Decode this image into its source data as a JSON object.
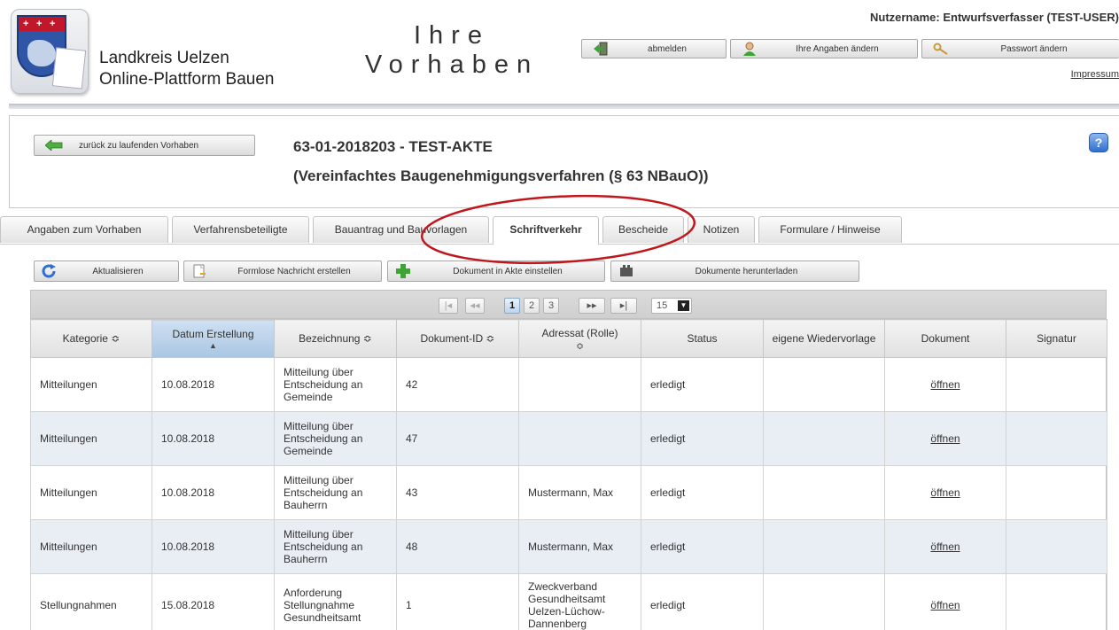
{
  "brand": {
    "line1": "Landkreis Uelzen",
    "line2": "Online-Plattform Bauen",
    "page_title_1": "Ihre",
    "page_title_2": "Vorhaben"
  },
  "user": {
    "username_label": "Nutzername: Entwurfsverfasser (TEST-USER)",
    "logout_label": "abmelden",
    "edit_profile_label": "Ihre Angaben ändern",
    "change_password_label": "Passwort ändern",
    "impressum_label": "Impressum"
  },
  "case": {
    "back_label": "zurück zu laufenden Vorhaben",
    "title": "63-01-2018203 - TEST-AKTE",
    "subtitle": "(Vereinfachtes Baugenehmigungsverfahren (§ 63 NBauO))",
    "help_label": "?"
  },
  "tabs": [
    {
      "label": "Angaben zum Vorhaben",
      "active": false
    },
    {
      "label": "Verfahrensbeteiligte",
      "active": false
    },
    {
      "label": "Bauantrag und Bauvorlagen",
      "active": false
    },
    {
      "label": "Schriftverkehr",
      "active": true
    },
    {
      "label": "Bescheide",
      "active": false
    },
    {
      "label": "Notizen",
      "active": false
    },
    {
      "label": "Formulare / Hinweise",
      "active": false
    }
  ],
  "toolbar": {
    "refresh_label": "Aktualisieren",
    "message_label": "Formlose Nachricht erstellen",
    "add_document_label": "Dokument in Akte einstellen",
    "download_label": "Dokumente herunterladen"
  },
  "pager": {
    "first": "|◂",
    "prev": "◂◂",
    "pages": [
      "1",
      "2",
      "3"
    ],
    "current_page": "1",
    "next": "▸▸",
    "last": "▸|",
    "page_size": "15"
  },
  "table": {
    "columns": [
      {
        "label": "Kategorie",
        "sort": "≎"
      },
      {
        "label": "Datum Erstellung",
        "sort": "▲"
      },
      {
        "label": "Bezeichnung",
        "sort": "≎"
      },
      {
        "label": "Dokument-ID",
        "sort": "≎"
      },
      {
        "label": "Adressat (Rolle)",
        "sort": "≎"
      },
      {
        "label": "Status",
        "sort": ""
      },
      {
        "label": "eigene Wiedervorlage",
        "sort": ""
      },
      {
        "label": "Dokument",
        "sort": ""
      },
      {
        "label": "Signatur",
        "sort": ""
      }
    ],
    "rows": [
      {
        "kategorie": "Mitteilungen",
        "datum": "10.08.2018",
        "bezeichnung": "Mitteilung über Entscheidung an Gemeinde",
        "id": "42",
        "adressat": "",
        "status": "erledigt",
        "wiedervorlage": "",
        "dokument": "öffnen",
        "signatur": ""
      },
      {
        "kategorie": "Mitteilungen",
        "datum": "10.08.2018",
        "bezeichnung": "Mitteilung über Entscheidung an Gemeinde",
        "id": "47",
        "adressat": "",
        "status": "erledigt",
        "wiedervorlage": "",
        "dokument": "öffnen",
        "signatur": ""
      },
      {
        "kategorie": "Mitteilungen",
        "datum": "10.08.2018",
        "bezeichnung": "Mitteilung über Entscheidung an Bauherrn",
        "id": "43",
        "adressat": "Mustermann, Max",
        "status": "erledigt",
        "wiedervorlage": "",
        "dokument": "öffnen",
        "signatur": ""
      },
      {
        "kategorie": "Mitteilungen",
        "datum": "10.08.2018",
        "bezeichnung": "Mitteilung über Entscheidung an Bauherrn",
        "id": "48",
        "adressat": "Mustermann, Max",
        "status": "erledigt",
        "wiedervorlage": "",
        "dokument": "öffnen",
        "signatur": ""
      },
      {
        "kategorie": "Stellungnahmen",
        "datum": "15.08.2018",
        "bezeichnung": "Anforderung Stellungnahme Gesundheitsamt",
        "id": "1",
        "adressat": "Zweckverband Gesundheitsamt Uelzen-Lüchow-Dannenberg",
        "status": "erledigt",
        "wiedervorlage": "",
        "dokument": "öffnen",
        "signatur": ""
      }
    ]
  },
  "colors": {
    "accent_blue": "#2f6fd1",
    "annotation_red": "#c0161c",
    "row_alt": "#e9eef5",
    "sorted_header": "#a9c6e4"
  }
}
